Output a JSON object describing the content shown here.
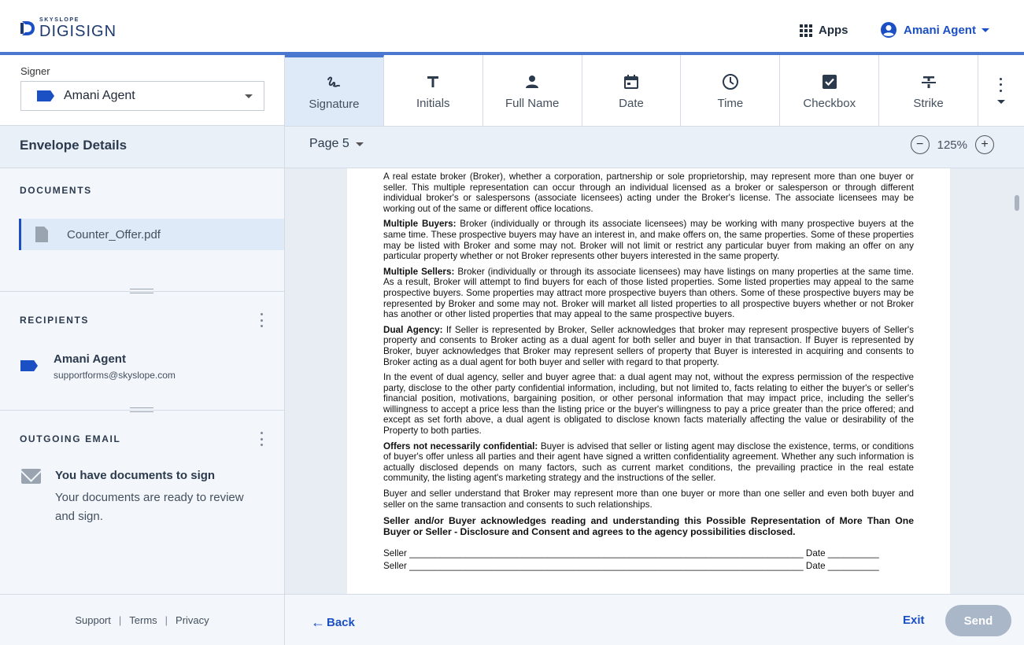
{
  "header": {
    "logo_small": "SKYSLOPE",
    "logo_main": "DIGISIGN",
    "apps_label": "Apps",
    "user_name": "Amani Agent"
  },
  "signer": {
    "label": "Signer",
    "selected": "Amani Agent"
  },
  "envelope": {
    "title": "Envelope Details",
    "documents_title": "DOCUMENTS",
    "documents": [
      "Counter_Offer.pdf"
    ],
    "recipients_title": "RECIPIENTS",
    "recipient": {
      "name": "Amani Agent",
      "email": "supportforms@skyslope.com"
    },
    "outgoing_title": "OUTGOING EMAIL",
    "email_subject": "You have documents to sign",
    "email_body": "Your documents are ready to review and sign."
  },
  "footer": {
    "support": "Support",
    "terms": "Terms",
    "privacy": "Privacy",
    "separator": "|"
  },
  "tools": [
    {
      "label": "Signature",
      "icon": "signature-icon",
      "active": true
    },
    {
      "label": "Initials",
      "icon": "initials-icon"
    },
    {
      "label": "Full Name",
      "icon": "person-icon"
    },
    {
      "label": "Date",
      "icon": "calendar-icon"
    },
    {
      "label": "Time",
      "icon": "clock-icon"
    },
    {
      "label": "Checkbox",
      "icon": "checkbox-icon"
    },
    {
      "label": "Strike",
      "icon": "strikethrough-icon"
    }
  ],
  "viewer": {
    "page_label": "Page 5",
    "zoom": "125%",
    "zoom_out": "−",
    "zoom_in": "+"
  },
  "document": {
    "p1": "A real estate broker (Broker), whether a corporation, partnership or sole proprietorship, may represent more than one buyer or seller. This multiple representation can occur through an individual licensed as a broker or salesperson or through different individual broker's or salespersons (associate licensees) acting under the Broker's license. The associate licensees may be working out of the same or different office locations.",
    "p2_head": "Multiple Buyers:",
    "p2": " Broker (individually or through its associate licensees) may be working with many prospective buyers at the same time. These prospective buyers may have an interest in, and make offers on, the same properties. Some of these properties may be listed with Broker and some may not. Broker will not limit or restrict any particular buyer from making an offer on any particular property whether or not Broker represents other buyers interested in the same property.",
    "p3_head": "Multiple Sellers:",
    "p3": " Broker (individually or through its associate licensees) may have listings on many properties at the same time. As a result, Broker will attempt to find buyers for each of those listed properties. Some listed properties may appeal to the same prospective buyers. Some properties may attract more prospective buyers than others. Some of these prospective buyers may be represented by Broker and some may not. Broker will market all listed properties to all prospective buyers whether or not Broker has another or other listed properties that may appeal to the same prospective buyers.",
    "p4_head": "Dual Agency:",
    "p4": " If Seller is represented by Broker, Seller acknowledges that broker may represent prospective buyers of Seller's property and consents to Broker acting as a dual agent for both seller and buyer in that transaction. If Buyer is represented by Broker, buyer acknowledges that Broker may represent sellers of property that Buyer is interested in acquiring and consents to Broker acting as a dual agent for both buyer and seller with regard to that property.",
    "p5": "In the event of dual agency, seller and buyer agree that: a dual agent may not, without the express permission of the respective party, disclose to the other party confidential information, including, but not limited to, facts relating to either the buyer's or seller's financial position, motivations, bargaining position, or other personal information that may impact price, including the seller's willingness to accept a price less than the listing price or the buyer's willingness to pay a price greater than the price offered; and except as set forth above, a dual agent is obligated to disclose known facts materially affecting the value or desirability of the Property to both parties.",
    "p6_head": "Offers not necessarily confidential:",
    "p6": " Buyer is advised that seller or listing agent may disclose the existence, terms, or conditions of buyer's offer unless all parties and their agent have signed a written confidentiality agreement. Whether any such information is actually disclosed depends on many factors, such as current market conditions, the prevailing practice in the real estate community, the listing agent's marketing strategy and the instructions of the seller.",
    "p7": "Buyer and seller understand that Broker may represent more than one buyer or more than one seller and even both buyer and seller on the same transaction and consents to such relationships.",
    "ack": "Seller and/or Buyer acknowledges reading and understanding this Possible Representation of More Than One Buyer or Seller - Disclosure and Consent and agrees to the agency possibilities disclosed.",
    "sig1": "Seller _____________________________________________________________________________  Date __________",
    "sig2": "Seller _____________________________________________________________________________  Date __________"
  },
  "bottom": {
    "back": "Back",
    "exit": "Exit",
    "send": "Send"
  },
  "colors": {
    "accent": "#1b4fc4",
    "active_tab_bg": "#dfeaf8",
    "send_disabled": "#a9b7c8"
  }
}
